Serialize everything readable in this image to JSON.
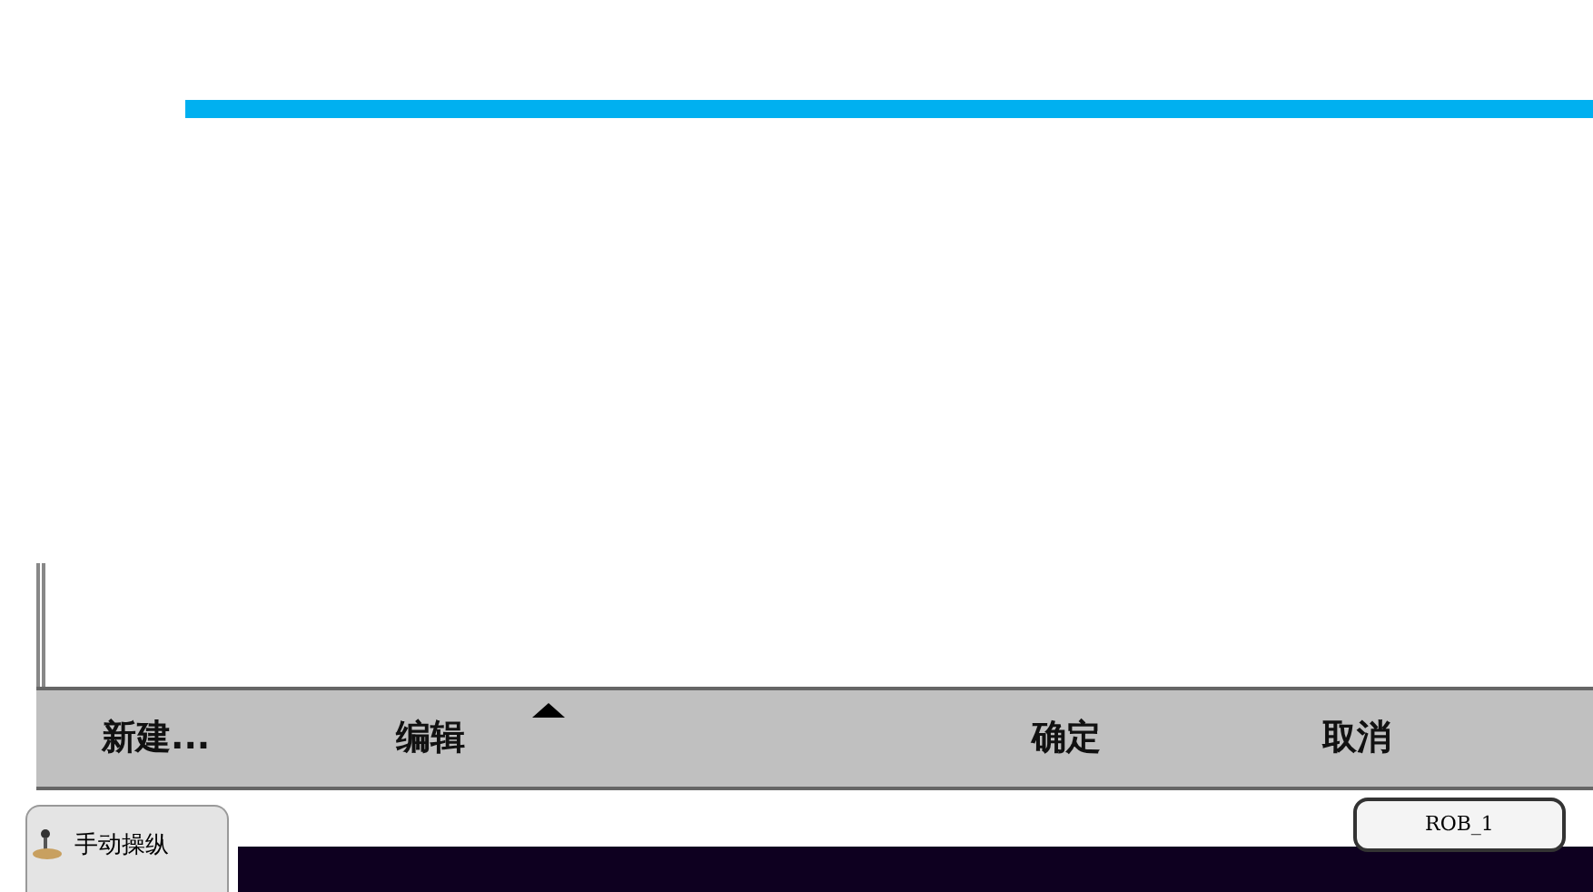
{
  "toolbar": {
    "buttons": [
      {
        "label": "新建..."
      },
      {
        "label": "编辑",
        "kind": "menu"
      },
      {
        "label": "确定"
      },
      {
        "label": "取消"
      }
    ]
  },
  "taskbar": {
    "tabs": [
      {
        "label": "手动操纵",
        "selected": true
      }
    ],
    "unit": {
      "label": "ROB_1"
    }
  }
}
